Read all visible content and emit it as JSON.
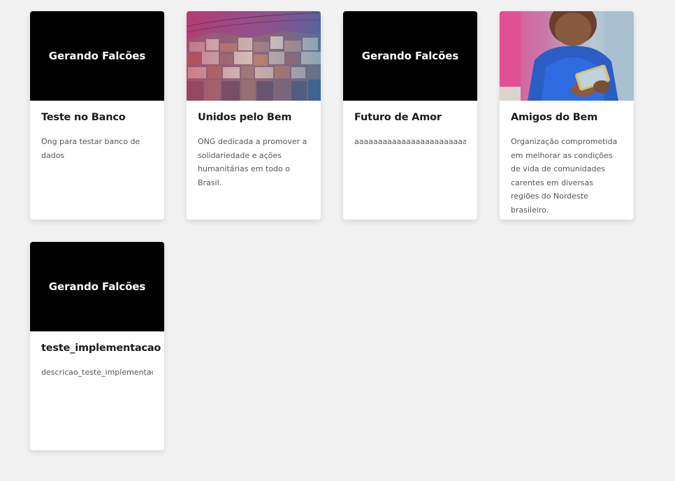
{
  "colors": {
    "page_background": "#f2f2f2",
    "card_background": "#ffffff",
    "placeholder_background": "#000000",
    "placeholder_text": "#ffffff",
    "title_text": "#1b1b1b",
    "description_text": "#555555"
  },
  "cards": [
    {
      "image": "placeholder",
      "image_text": "Gerando Falcões",
      "title": "Teste no Banco",
      "description": "Ong para testar banco de dados"
    },
    {
      "image": "photo-favela-hillside",
      "title": "Unidos pelo Bem",
      "description": "ONG dedicada a promover a solidariedade e ações humanitárias em todo o Brasil."
    },
    {
      "image": "placeholder",
      "image_text": "Gerando Falcões",
      "title": "Futuro de Amor",
      "description": "aaaaaaaaaaaaaaaaaaaaaaaaaaaaaaaaaaaa"
    },
    {
      "image": "photo-child-with-phone",
      "title": "Amigos do Bem",
      "description": "Organização comprometida em melhorar as condições de vida de comunidades carentes em diversas regiões do Nordeste brasileiro."
    },
    {
      "image": "placeholder",
      "image_text": "Gerando Falcões",
      "title": "teste_implementacao",
      "description": "descricao_teste_implementacao"
    }
  ]
}
